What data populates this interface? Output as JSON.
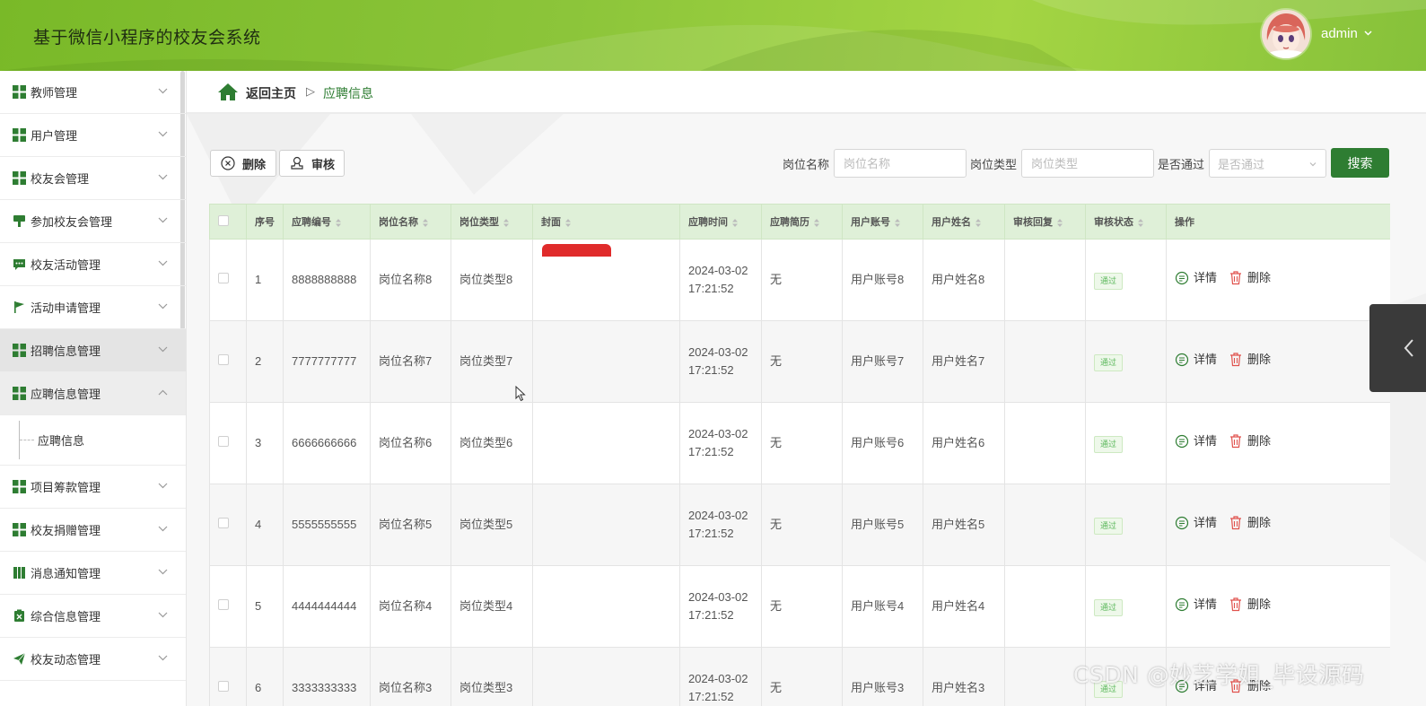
{
  "header": {
    "title": "基于微信小程序的校友会系统",
    "user_name": "admin"
  },
  "sidebar": {
    "items": [
      {
        "label": "教师管理",
        "icon": "grid-icon"
      },
      {
        "label": "用户管理",
        "icon": "grid-icon"
      },
      {
        "label": "校友会管理",
        "icon": "grid-icon"
      },
      {
        "label": "参加校友会管理",
        "icon": "pin-icon"
      },
      {
        "label": "校友活动管理",
        "icon": "chat-icon"
      },
      {
        "label": "活动申请管理",
        "icon": "flag-icon"
      },
      {
        "label": "招聘信息管理",
        "icon": "grid-icon"
      },
      {
        "label": "应聘信息管理",
        "icon": "grid-icon"
      },
      {
        "label": "项目筹款管理",
        "icon": "grid-icon"
      },
      {
        "label": "校友捐赠管理",
        "icon": "grid-icon"
      },
      {
        "label": "消息通知管理",
        "icon": "book-icon"
      },
      {
        "label": "综合信息管理",
        "icon": "clipboard-icon"
      },
      {
        "label": "校友动态管理",
        "icon": "send-icon"
      }
    ],
    "sub_item": "应聘信息"
  },
  "breadcrumb": {
    "home": "返回主页",
    "separator": "▷",
    "current": "应聘信息"
  },
  "toolbar": {
    "delete_label": "删除",
    "audit_label": "审核"
  },
  "search": {
    "post_name_label": "岗位名称",
    "post_name_placeholder": "岗位名称",
    "post_type_label": "岗位类型",
    "post_type_placeholder": "岗位类型",
    "passed_label": "是否通过",
    "passed_placeholder": "是否通过",
    "search_button": "搜索"
  },
  "table": {
    "headers": [
      "序号",
      "应聘编号",
      "岗位名称",
      "岗位类型",
      "封面",
      "应聘时间",
      "应聘简历",
      "用户账号",
      "用户姓名",
      "审核回复",
      "审核状态",
      "操作"
    ],
    "rows": [
      {
        "index": "1",
        "code": "8888888888",
        "post_name": "岗位名称8",
        "post_type": "岗位类型8",
        "date": "2024-03-02",
        "time": "17:21:52",
        "resume": "无",
        "account": "用户账号8",
        "user_name": "用户姓名8",
        "reply": "",
        "status": "通过"
      },
      {
        "index": "2",
        "code": "7777777777",
        "post_name": "岗位名称7",
        "post_type": "岗位类型7",
        "date": "2024-03-02",
        "time": "17:21:52",
        "resume": "无",
        "account": "用户账号7",
        "user_name": "用户姓名7",
        "reply": "",
        "status": "通过"
      },
      {
        "index": "3",
        "code": "6666666666",
        "post_name": "岗位名称6",
        "post_type": "岗位类型6",
        "date": "2024-03-02",
        "time": "17:21:52",
        "resume": "无",
        "account": "用户账号6",
        "user_name": "用户姓名6",
        "reply": "",
        "status": "通过"
      },
      {
        "index": "4",
        "code": "5555555555",
        "post_name": "岗位名称5",
        "post_type": "岗位类型5",
        "date": "2024-03-02",
        "time": "17:21:52",
        "resume": "无",
        "account": "用户账号5",
        "user_name": "用户姓名5",
        "reply": "",
        "status": "通过"
      },
      {
        "index": "5",
        "code": "4444444444",
        "post_name": "岗位名称4",
        "post_type": "岗位类型4",
        "date": "2024-03-02",
        "time": "17:21:52",
        "resume": "无",
        "account": "用户账号4",
        "user_name": "用户姓名4",
        "reply": "",
        "status": "通过"
      },
      {
        "index": "6",
        "code": "3333333333",
        "post_name": "岗位名称3",
        "post_type": "岗位类型3",
        "date": "2024-03-02",
        "time": "17:21:52",
        "resume": "无",
        "account": "用户账号3",
        "user_name": "用户姓名3",
        "reply": "",
        "status": "通过"
      }
    ],
    "actions": {
      "detail": "详情",
      "delete": "删除"
    }
  },
  "watermark": "CSDN @妙芝学姐_毕设源码",
  "colors": {
    "primary": "#2e7d32",
    "header_green": "#8cc53a",
    "table_header": "#dff0d8",
    "danger": "#e0524d"
  }
}
